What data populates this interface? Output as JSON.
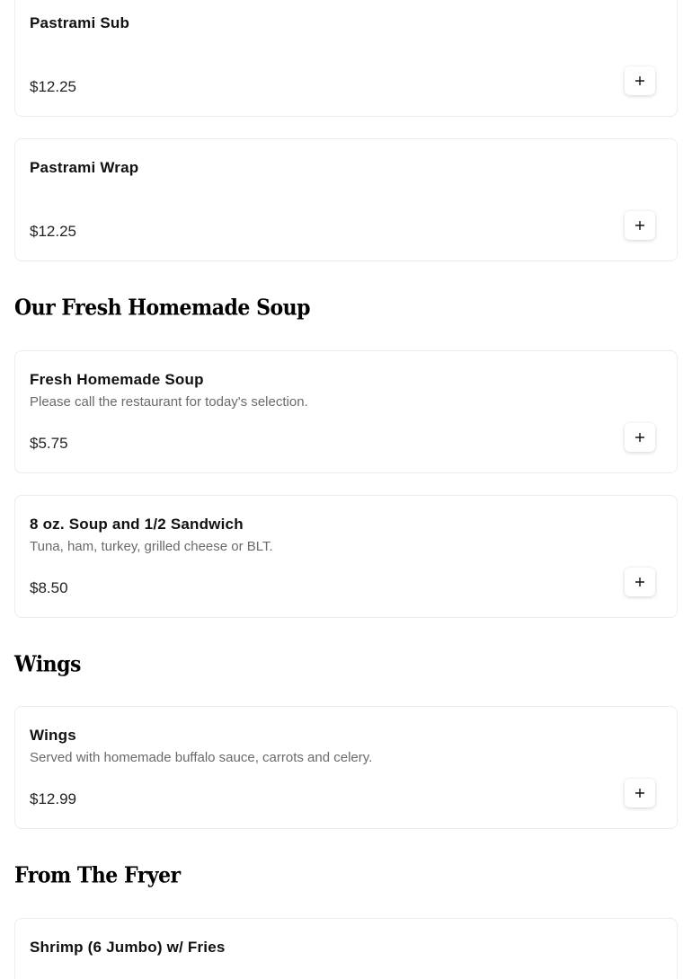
{
  "sections": {
    "soup_title": "Our Fresh Homemade Soup",
    "wings_title": "Wings",
    "fryer_title": "From The Fryer"
  },
  "items": [
    {
      "name": "Pastrami Sub",
      "description": "",
      "price": "$12.25"
    },
    {
      "name": "Pastrami Wrap",
      "description": "",
      "price": "$12.25"
    },
    {
      "name": "Fresh Homemade Soup",
      "description": "Please call the restaurant for today's selection.",
      "price": "$5.75"
    },
    {
      "name": "8 oz. Soup and 1/2 Sandwich",
      "description": "Tuna, ham, turkey, grilled cheese or BLT.",
      "price": "$8.50"
    },
    {
      "name": "Wings",
      "description": "Served with homemade buffalo sauce, carrots and celery.",
      "price": "$12.99"
    },
    {
      "name": "Shrimp (6 Jumbo) w/ Fries",
      "description": "",
      "price": ""
    }
  ],
  "icons": {
    "add": "plus-icon"
  }
}
